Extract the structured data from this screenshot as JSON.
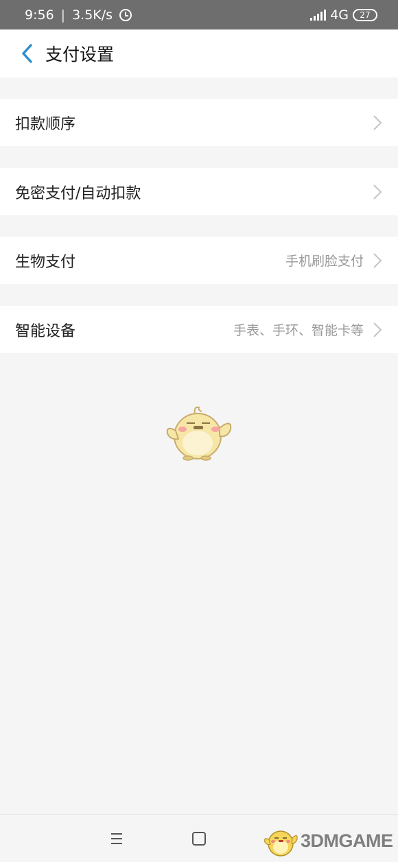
{
  "status_bar": {
    "time": "9:56",
    "separator": "|",
    "speed": "3.5K/s",
    "network": "4G",
    "battery": "27",
    "icons": [
      "alarm-icon",
      "signal-icon",
      "battery-icon"
    ]
  },
  "nav": {
    "title": "支付设置",
    "back_icon": "chevron-left-icon",
    "accent_color": "#2a8fd0"
  },
  "menu": {
    "items": [
      {
        "label": "扣款顺序",
        "value": ""
      },
      {
        "label": "免密支付/自动扣款",
        "value": ""
      },
      {
        "label": "生物支付",
        "value": "手机刷脸支付"
      },
      {
        "label": "智能设备",
        "value": "手表、手环、智能卡等"
      }
    ]
  },
  "mascot": {
    "icon": "penguin-mascot-icon"
  },
  "system_nav": {
    "icons": [
      "menu-icon",
      "home-icon"
    ]
  },
  "watermark": {
    "text": "3DMGAME"
  }
}
